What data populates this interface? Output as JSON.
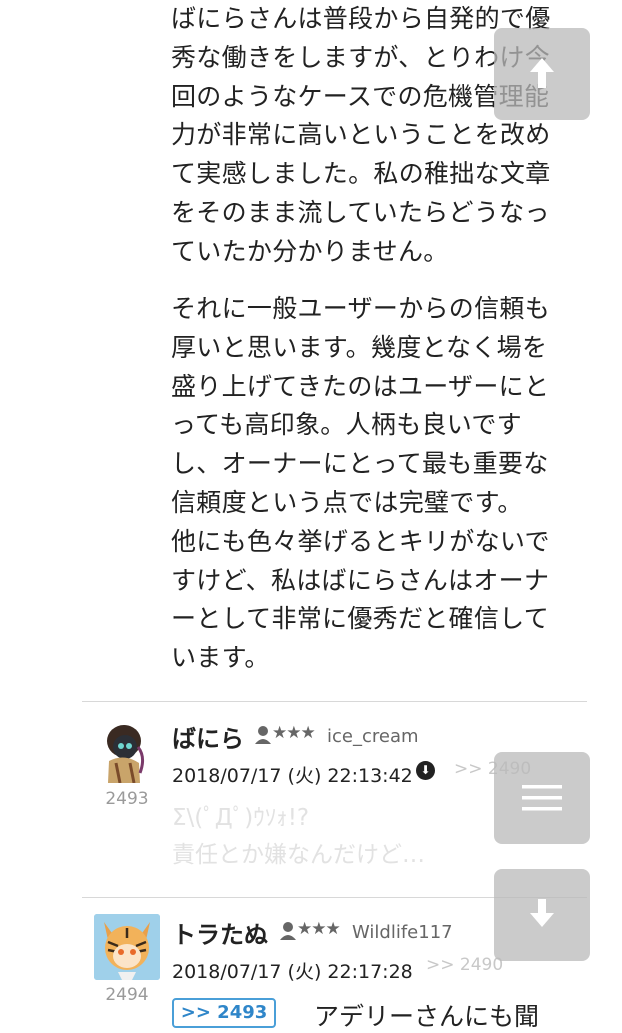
{
  "paragraph1": [
    "ばにらさんは普段から自発的で優",
    "秀な働きをしますが、とりわけ今",
    "回のようなケースでの危機管理能",
    "力が非常に高いということを改め",
    "て実感しました。私の稚拙な文章",
    "をそのまま流していたらどうなっ",
    "ていたか分かりません。"
  ],
  "paragraph2": [
    "それに一般ユーザーからの信頼も",
    "厚いと思います。幾度となく場を",
    "盛り上げてきたのはユーザーにと",
    "っても高印象。人柄も良いです",
    "し、オーナーにとって最も重要な",
    "信頼度という点では完璧です。",
    "他にも色々挙げるとキリがないで",
    "すけど、私はばにらさんはオーナ",
    "ーとして非常に優秀だと確信して",
    "います。"
  ],
  "posts": [
    {
      "number": "2493",
      "name": "ばにら",
      "rank_icon": "★★★",
      "user_id": "ice_cream",
      "date": "2018/07/17 (火) 22:13:42",
      "reply_to": ">> 2490",
      "body_lines": [
        "Σ\\(ﾟДﾟ)ｳｿｫ!?",
        "責任とか嫌なんだけど…"
      ]
    },
    {
      "number": "2494",
      "name": "トラたぬ",
      "rank_icon": "★★★",
      "user_id": "Wildlife117",
      "date": "2018/07/17 (火) 22:17:28",
      "reply_to": ">> 2490",
      "anchor": ">> 2493",
      "body_start": "アデリーさんにも聞"
    }
  ],
  "colors": {
    "anchor_blue": "#2f86c9",
    "float_button": "#b9b9b9"
  },
  "buttons": {
    "scroll_top_icon": "arrow-up-icon",
    "menu_icon": "hamburger-icon",
    "scroll_bottom_icon": "arrow-down-icon"
  }
}
